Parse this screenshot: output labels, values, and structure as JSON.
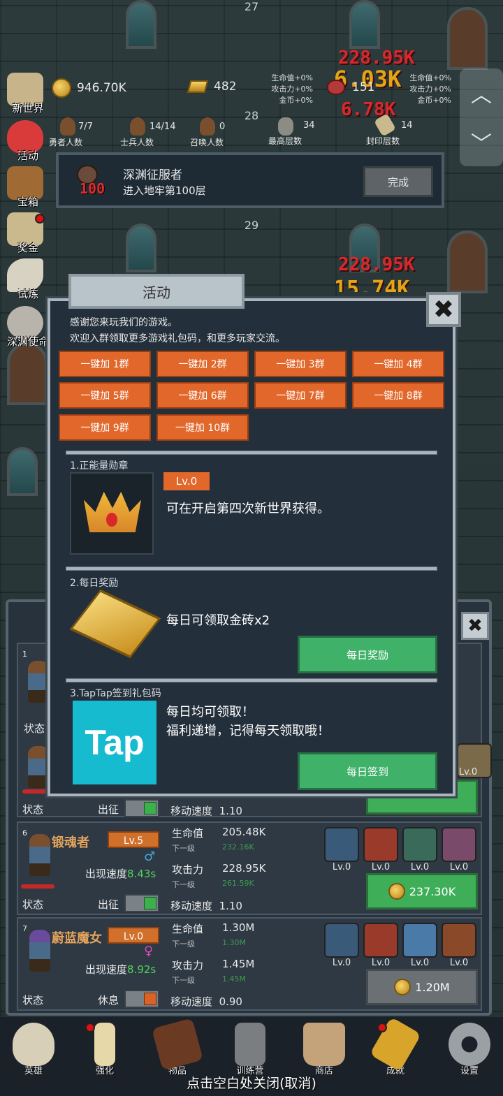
{
  "floors": [
    "27",
    "28",
    "29"
  ],
  "damage": {
    "a": "228.95K",
    "b": "6.03K",
    "c": "6.78K",
    "d": "228.95K",
    "e": "15.74K"
  },
  "resources": {
    "gold": "946.70K",
    "gold_bars": "482",
    "meat": "151",
    "bonus_left": [
      "生命值+0%",
      "攻击力+0%",
      "金币+0%"
    ],
    "bonus_right": [
      "生命值+0%",
      "攻击力+0%",
      "金币+0%"
    ]
  },
  "counts": [
    {
      "value": "7/7",
      "label": "勇者人数"
    },
    {
      "value": "14/14",
      "label": "士兵人数"
    },
    {
      "value": "0",
      "label": "召唤人数"
    },
    {
      "value": "34",
      "label": "最高层数"
    },
    {
      "value": "14",
      "label": "封印层数"
    }
  ],
  "left_menu": [
    "新世界",
    "活动",
    "宝箱",
    "奖金",
    "试炼",
    "深渊使命"
  ],
  "quest": {
    "icon_badge": "100",
    "title": "深渊征服者",
    "desc": "进入地牢第100层",
    "button": "完成"
  },
  "modal": {
    "title": "活动",
    "close": "✖",
    "intro1": "感谢您来玩我们的游戏。",
    "intro2": "欢迎入群领取更多游戏礼包码，和更多玩家交流。",
    "groups": [
      "一键加 1群",
      "一键加 2群",
      "一键加 3群",
      "一键加 4群",
      "一键加 5群",
      "一键加 6群",
      "一键加 7群",
      "一键加 8群",
      "一键加 9群",
      "一键加 10群"
    ],
    "sec1_title": "1.正能量勋章",
    "sec1_lv": "Lv.0",
    "sec1_text": "可在开启第四次新世界获得。",
    "sec2_title": "2.每日奖励",
    "sec2_text": "每日可领取金砖x2",
    "sec2_btn": "每日奖励",
    "sec3_title": "3.TapTap签到礼包码",
    "sec3_logo": "Tap",
    "sec3_text1": "每日均可领取！",
    "sec3_text2": "福利递增，记得每天领取哦！",
    "sec3_btn": "每日签到"
  },
  "heroes": [
    {
      "num": "1",
      "status_label": "状态",
      "move_label": "移动速度",
      "move_value": "1.10",
      "deploy_label": "出征"
    },
    {
      "num": "6",
      "name": "锻魂者",
      "lv": "Lv.5",
      "spawn_label": "出现速度",
      "spawn_value": "8.43s",
      "hp_label": "生命值",
      "hp_value": "205.48K",
      "next_label": "下一级",
      "hp_next": "232.16K",
      "atk_label": "攻击力",
      "atk_value": "228.95K",
      "atk_next": "261.59K",
      "move_label": "移动速度",
      "move_value": "1.10",
      "status_label": "状态",
      "deploy_label": "出征",
      "gear_lv": [
        "Lv.0",
        "Lv.0",
        "Lv.0",
        "Lv.0"
      ],
      "cost": "237.30K"
    },
    {
      "num": "7",
      "name": "蔚蓝魔女",
      "lv": "Lv.0",
      "spawn_label": "出现速度",
      "spawn_value": "8.92s",
      "hp_label": "生命值",
      "hp_value": "1.30M",
      "next_label": "下一级",
      "hp_next": "1.30M",
      "atk_label": "攻击力",
      "atk_value": "1.45M",
      "atk_next": "1.45M",
      "move_label": "移动速度",
      "move_value": "0.90",
      "status_label": "状态",
      "deploy_label": "休息",
      "gear_lv": [
        "Lv.0",
        "Lv.0",
        "Lv.0",
        "Lv.0"
      ],
      "cost": "1.20M"
    }
  ],
  "upper_gear_lv": "Lv.0",
  "bottom_nav": [
    "英雄",
    "强化",
    "物品",
    "训练营",
    "商店",
    "成就",
    "设置"
  ],
  "close_hint": "点击空白处关闭(取消)"
}
